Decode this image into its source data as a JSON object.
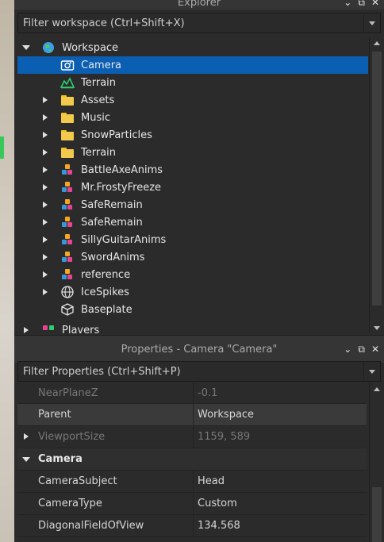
{
  "explorer": {
    "title": "Explorer",
    "filter_placeholder": "Filter workspace (Ctrl+Shift+X)",
    "items": [
      {
        "label": "Workspace",
        "icon": "workspace-globe-icon"
      },
      {
        "label": "Camera",
        "icon": "camera-icon",
        "selected": true
      },
      {
        "label": "Terrain",
        "icon": "terrain-icon"
      },
      {
        "label": "Assets",
        "icon": "folder-icon"
      },
      {
        "label": "Music",
        "icon": "folder-icon"
      },
      {
        "label": "SnowParticles",
        "icon": "folder-icon"
      },
      {
        "label": "Terrain",
        "icon": "folder-icon"
      },
      {
        "label": "BattleAxeAnims",
        "icon": "model-icon"
      },
      {
        "label": "Mr.FrostyFreeze",
        "icon": "model-icon"
      },
      {
        "label": "SafeRemain",
        "icon": "model-icon"
      },
      {
        "label": "SafeRemain",
        "icon": "model-icon"
      },
      {
        "label": "SillyGuitarAnims",
        "icon": "model-icon"
      },
      {
        "label": "SwordAnims",
        "icon": "model-icon"
      },
      {
        "label": "reference",
        "icon": "model-icon"
      },
      {
        "label": "IceSpikes",
        "icon": "globe-icon"
      },
      {
        "label": "Baseplate",
        "icon": "part-icon"
      },
      {
        "label": "Players",
        "icon": "players-icon"
      }
    ]
  },
  "properties": {
    "title": "Properties - Camera \"Camera\"",
    "filter_placeholder": "Filter Properties (Ctrl+Shift+P)",
    "rows": [
      {
        "name": "NearPlaneZ",
        "value": "-0.1"
      },
      {
        "name": "Parent",
        "value": "Workspace"
      },
      {
        "name": "ViewportSize",
        "value": "1159, 589"
      },
      {
        "name": "Camera",
        "value": ""
      },
      {
        "name": "CameraSubject",
        "value": "Head"
      },
      {
        "name": "CameraType",
        "value": "Custom"
      },
      {
        "name": "DiagonalFieldOfView",
        "value": "134.568"
      }
    ]
  },
  "colors": {
    "selection": "#0b5fb3",
    "panel_bg": "#2b2b2b"
  }
}
